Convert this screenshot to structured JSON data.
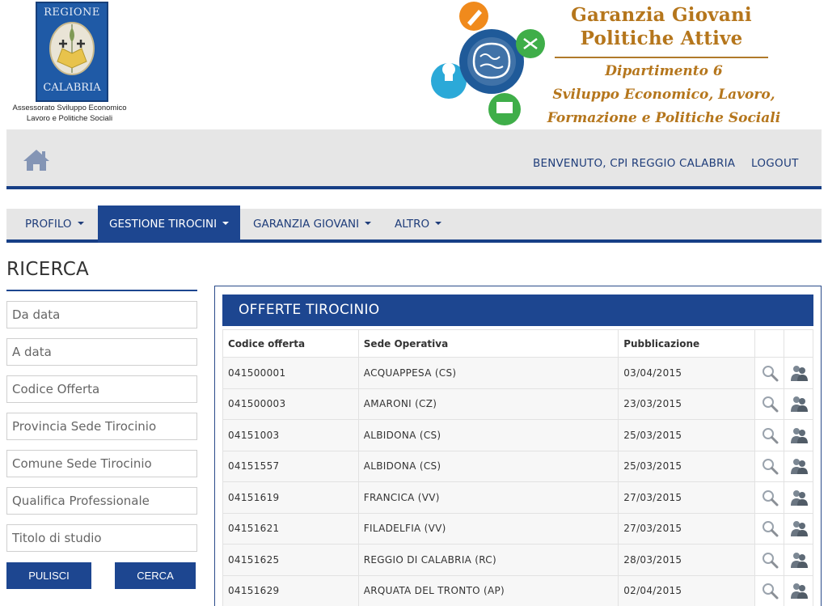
{
  "header": {
    "regione_top": "REGIONE",
    "regione_bottom": "CALABRIA",
    "assessorato_line1": "Assessorato Sviluppo Economico",
    "assessorato_line2": "Lavoro e Politiche Sociali",
    "gg_title_line1": "Garanzia Giovani",
    "gg_title_line2": "Politiche Attive",
    "gg_sub_line1": "Dipartimento 6",
    "gg_sub_line2": "Sviluppo Economico, Lavoro,",
    "gg_sub_line3": "Formazione e Politiche Sociali"
  },
  "topbar": {
    "home_icon": "home-icon",
    "welcome": "BENVENUTO, CPI REGGIO CALABRIA",
    "logout": "LOGOUT"
  },
  "menu": {
    "items": [
      {
        "label": "PROFILO",
        "active": false
      },
      {
        "label": "GESTIONE TIROCINI",
        "active": true
      },
      {
        "label": "GARANZIA GIOVANI",
        "active": false
      },
      {
        "label": "ALTRO",
        "active": false
      }
    ]
  },
  "ricerca": {
    "title": "RICERCA",
    "fields": [
      {
        "placeholder": "Da data"
      },
      {
        "placeholder": "A data"
      },
      {
        "placeholder": "Codice Offerta"
      },
      {
        "placeholder": "Provincia Sede Tirocinio"
      },
      {
        "placeholder": "Comune Sede Tirocinio"
      },
      {
        "placeholder": "Qualifica Professionale"
      },
      {
        "placeholder": "Titolo di studio"
      }
    ],
    "pulisci": "PULISCI",
    "cerca": "CERCA"
  },
  "offerte": {
    "title": "OFFERTE TIROCINIO",
    "columns": [
      "Codice offerta",
      "Sede Operativa",
      "Pubblicazione"
    ],
    "rows": [
      {
        "codice": "041500001",
        "sede": "ACQUAPPESA (CS)",
        "data": "03/04/2015"
      },
      {
        "codice": "041500003",
        "sede": "AMARONI (CZ)",
        "data": "23/03/2015"
      },
      {
        "codice": "04151003",
        "sede": "ALBIDONA (CS)",
        "data": "25/03/2015"
      },
      {
        "codice": "04151557",
        "sede": "ALBIDONA (CS)",
        "data": "25/03/2015"
      },
      {
        "codice": "04151619",
        "sede": "FRANCICA (VV)",
        "data": "27/03/2015"
      },
      {
        "codice": "04151621",
        "sede": "FILADELFIA (VV)",
        "data": "27/03/2015"
      },
      {
        "codice": "04151625",
        "sede": "REGGIO DI CALABRIA (RC)",
        "data": "28/03/2015"
      },
      {
        "codice": "04151629",
        "sede": "ARQUATA DEL TRONTO (AP)",
        "data": "02/04/2015"
      }
    ],
    "row_icons": [
      "magnifier-icon",
      "people-icon"
    ]
  },
  "colors": {
    "brand_blue": "#1d4690",
    "gold": "#b5761c",
    "bar_gray": "#e6e6e6"
  }
}
